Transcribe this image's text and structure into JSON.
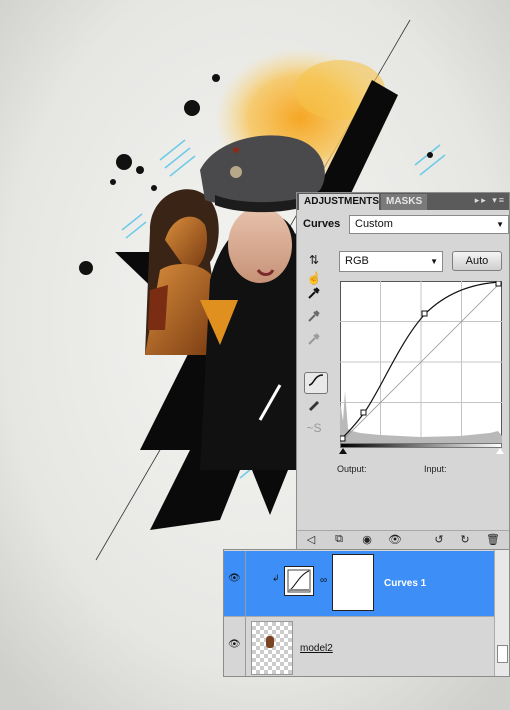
{
  "adjustments_panel": {
    "tabs": [
      {
        "label": "ADJUSTMENTS",
        "active": true
      },
      {
        "label": "MASKS",
        "active": false
      }
    ],
    "adjustment_type": "Curves",
    "preset_value": "Custom",
    "channel_value": "RGB",
    "auto_label": "Auto",
    "output_label": "Output:",
    "input_label": "Input:",
    "accent": "#3d8ff7"
  },
  "layers_panel": {
    "layers": [
      {
        "name": "Curves 1",
        "selected": true
      },
      {
        "name": "model2",
        "selected": false
      }
    ]
  },
  "colors": {
    "selection": "#3d8ff7",
    "panel_bg": "#d6d6d6",
    "splash_orange": "#f6b23a",
    "splash_cyan": "#4cc3e6"
  }
}
